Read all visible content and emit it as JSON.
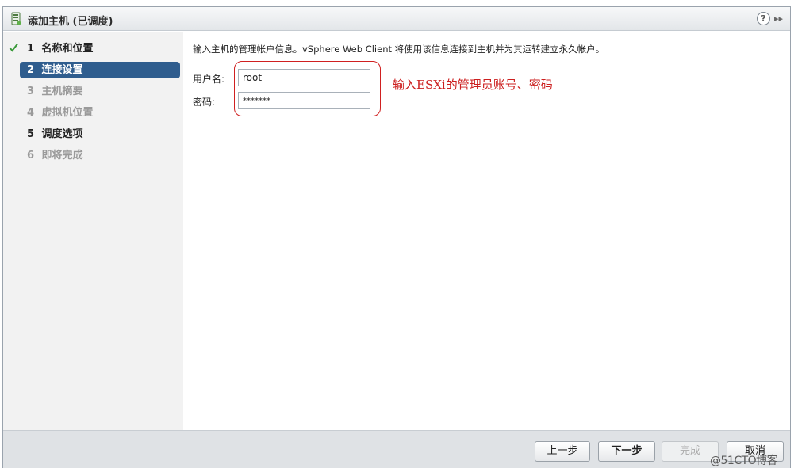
{
  "window": {
    "title": "添加主机 (已调度)"
  },
  "sidebar": {
    "steps": [
      {
        "num": "1",
        "label": "名称和位置"
      },
      {
        "num": "2",
        "label": "连接设置"
      },
      {
        "num": "3",
        "label": "主机摘要"
      },
      {
        "num": "4",
        "label": "虚拟机位置"
      },
      {
        "num": "5",
        "label": "调度选项"
      },
      {
        "num": "6",
        "label": "即将完成"
      }
    ]
  },
  "main": {
    "intro": "输入主机的管理帐户信息。vSphere Web Client 将使用该信息连接到主机并为其运转建立永久帐户。",
    "username_label": "用户名:",
    "username_value": "root",
    "password_label": "密码:",
    "password_value": "*******",
    "annotation": "输入ESXi的管理员账号、密码"
  },
  "footer": {
    "back_label": "上一步",
    "next_label": "下一步",
    "finish_label": "完成",
    "cancel_label": "取消"
  },
  "watermark": "@51CTO博客",
  "icons": {
    "title": "host-icon",
    "help": "help-icon",
    "expand": "expand-icon",
    "step_done": "check-icon"
  },
  "colors": {
    "active_step": "#2f5d8e",
    "annotation": "#cc1f1f",
    "check": "#3a9a3a"
  }
}
